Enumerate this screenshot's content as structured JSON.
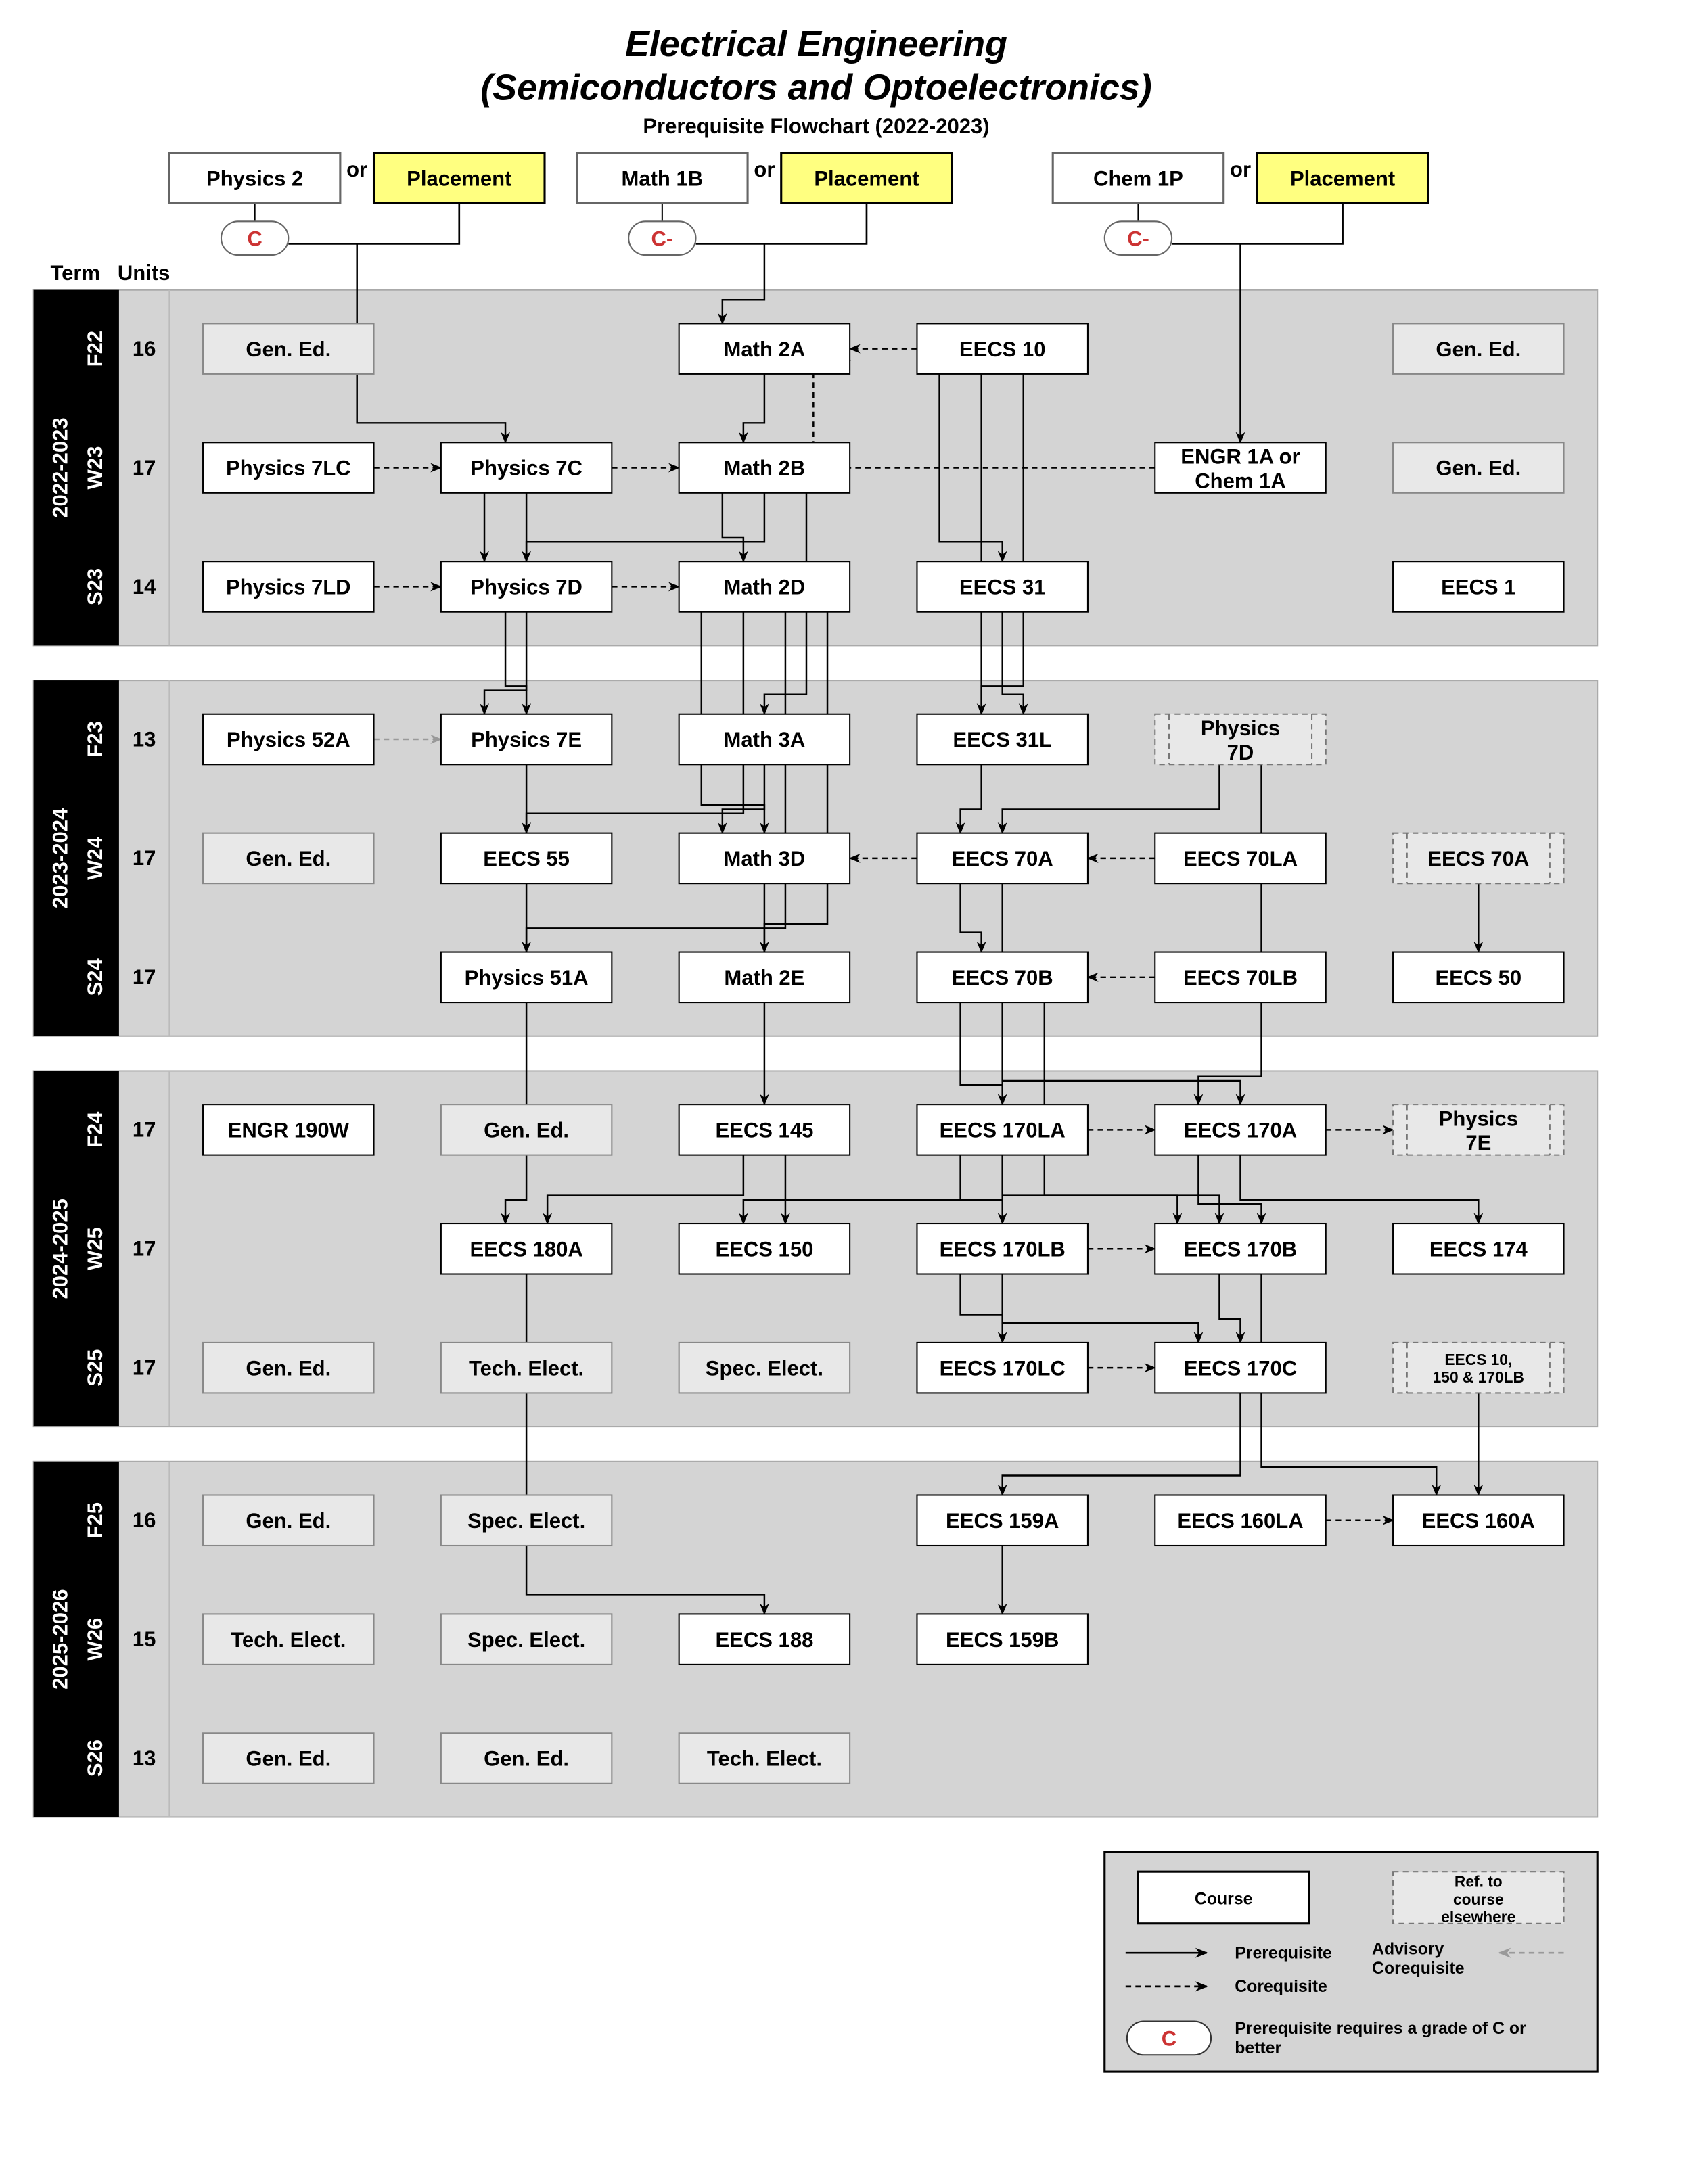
{
  "title": "Electrical Engineering",
  "subtitle_line": "(Semiconductors and Optoelectronics)",
  "caption": "Prerequisite Flowchart (2022-2023)",
  "header": {
    "term": "Term",
    "units": "Units"
  },
  "colors": {
    "band": "#d4d4d4",
    "placement": "#ffff80",
    "gen_ed": "#e8e8e8",
    "grade": "#cc3333",
    "advisory": "#999999"
  },
  "entry": [
    {
      "left": "Physics 2",
      "or": "or",
      "right": "Placement",
      "grade": "C"
    },
    {
      "left": "Math 1B",
      "or": "or",
      "right": "Placement",
      "grade": "C-"
    },
    {
      "left": "Chem 1P",
      "or": "or",
      "right": "Placement",
      "grade": "C-"
    }
  ],
  "years": [
    "2022-2023",
    "2023-2024",
    "2024-2025",
    "2025-2026"
  ],
  "terms": [
    {
      "label": "F22",
      "units": "16"
    },
    {
      "label": "W23",
      "units": "17"
    },
    {
      "label": "S23",
      "units": "14"
    },
    {
      "label": "F23",
      "units": "13"
    },
    {
      "label": "W24",
      "units": "17"
    },
    {
      "label": "S24",
      "units": "17"
    },
    {
      "label": "F24",
      "units": "17"
    },
    {
      "label": "W25",
      "units": "17"
    },
    {
      "label": "S25",
      "units": "17"
    },
    {
      "label": "F25",
      "units": "16"
    },
    {
      "label": "W26",
      "units": "15"
    },
    {
      "label": "S26",
      "units": "13"
    }
  ],
  "courses": [
    {
      "id": "ge1",
      "label": "Gen. Ed.",
      "term": 0,
      "col": 0,
      "kind": "gen"
    },
    {
      "id": "m2a",
      "label": "Math 2A",
      "term": 0,
      "col": 2
    },
    {
      "id": "e10",
      "label": "EECS 10",
      "term": 0,
      "col": 3
    },
    {
      "id": "ge2",
      "label": "Gen. Ed.",
      "term": 0,
      "col": 5,
      "kind": "gen"
    },
    {
      "id": "p7lc",
      "label": "Physics 7LC",
      "term": 1,
      "col": 0
    },
    {
      "id": "p7c",
      "label": "Physics 7C",
      "term": 1,
      "col": 1
    },
    {
      "id": "m2b",
      "label": "Math 2B",
      "term": 1,
      "col": 2
    },
    {
      "id": "engr1a",
      "label": "ENGR 1A or|Chem 1A",
      "term": 1,
      "col": 4
    },
    {
      "id": "ge3",
      "label": "Gen. Ed.",
      "term": 1,
      "col": 5,
      "kind": "gen"
    },
    {
      "id": "p7ld",
      "label": "Physics 7LD",
      "term": 2,
      "col": 0
    },
    {
      "id": "p7d",
      "label": "Physics 7D",
      "term": 2,
      "col": 1
    },
    {
      "id": "m2d",
      "label": "Math 2D",
      "term": 2,
      "col": 2
    },
    {
      "id": "e31",
      "label": "EECS 31",
      "term": 2,
      "col": 3
    },
    {
      "id": "e1",
      "label": "EECS 1",
      "term": 2,
      "col": 5
    },
    {
      "id": "p52a",
      "label": "Physics 52A",
      "term": 3,
      "col": 0
    },
    {
      "id": "p7e",
      "label": "Physics 7E",
      "term": 3,
      "col": 1
    },
    {
      "id": "m3a",
      "label": "Math 3A",
      "term": 3,
      "col": 2
    },
    {
      "id": "e31l",
      "label": "EECS 31L",
      "term": 3,
      "col": 3
    },
    {
      "id": "r7d",
      "label": "Physics|7D",
      "term": 3,
      "col": 4,
      "kind": "ref"
    },
    {
      "id": "ge4",
      "label": "Gen. Ed.",
      "term": 4,
      "col": 0,
      "kind": "gen"
    },
    {
      "id": "e55",
      "label": "EECS 55",
      "term": 4,
      "col": 1
    },
    {
      "id": "m3d",
      "label": "Math 3D",
      "term": 4,
      "col": 2
    },
    {
      "id": "e70a",
      "label": "EECS 70A",
      "term": 4,
      "col": 3
    },
    {
      "id": "e70la",
      "label": "EECS 70LA",
      "term": 4,
      "col": 4
    },
    {
      "id": "r70a",
      "label": "EECS 70A",
      "term": 4,
      "col": 5,
      "kind": "ref"
    },
    {
      "id": "p51a",
      "label": "Physics 51A",
      "term": 5,
      "col": 1
    },
    {
      "id": "m2e",
      "label": "Math 2E",
      "term": 5,
      "col": 2
    },
    {
      "id": "e70b",
      "label": "EECS 70B",
      "term": 5,
      "col": 3
    },
    {
      "id": "e70lb",
      "label": "EECS 70LB",
      "term": 5,
      "col": 4
    },
    {
      "id": "e50",
      "label": "EECS 50",
      "term": 5,
      "col": 5
    },
    {
      "id": "engr190w",
      "label": "ENGR 190W",
      "term": 6,
      "col": 0
    },
    {
      "id": "ge5",
      "label": "Gen. Ed.",
      "term": 6,
      "col": 1,
      "kind": "gen"
    },
    {
      "id": "e145",
      "label": "EECS 145",
      "term": 6,
      "col": 2
    },
    {
      "id": "e170la",
      "label": "EECS 170LA",
      "term": 6,
      "col": 3
    },
    {
      "id": "e170a",
      "label": "EECS 170A",
      "term": 6,
      "col": 4
    },
    {
      "id": "r7e",
      "label": "Physics|7E",
      "term": 6,
      "col": 5,
      "kind": "ref"
    },
    {
      "id": "e180a",
      "label": "EECS 180A",
      "term": 7,
      "col": 1
    },
    {
      "id": "e150",
      "label": "EECS 150",
      "term": 7,
      "col": 2
    },
    {
      "id": "e170lb",
      "label": "EECS 170LB",
      "term": 7,
      "col": 3
    },
    {
      "id": "e170b",
      "label": "EECS 170B",
      "term": 7,
      "col": 4
    },
    {
      "id": "e174",
      "label": "EECS 174",
      "term": 7,
      "col": 5
    },
    {
      "id": "ge6",
      "label": "Gen. Ed.",
      "term": 8,
      "col": 0,
      "kind": "gen"
    },
    {
      "id": "te1",
      "label": "Tech. Elect.",
      "term": 8,
      "col": 1,
      "kind": "gen"
    },
    {
      "id": "se1",
      "label": "Spec. Elect.",
      "term": 8,
      "col": 2,
      "kind": "gen"
    },
    {
      "id": "e170lc",
      "label": "EECS 170LC",
      "term": 8,
      "col": 3
    },
    {
      "id": "e170c",
      "label": "EECS 170C",
      "term": 8,
      "col": 4
    },
    {
      "id": "rmulti",
      "label": "EECS 10,|150 & 170LB",
      "term": 8,
      "col": 5,
      "kind": "ref",
      "small": true
    },
    {
      "id": "ge7",
      "label": "Gen. Ed.",
      "term": 9,
      "col": 0,
      "kind": "gen"
    },
    {
      "id": "se2",
      "label": "Spec. Elect.",
      "term": 9,
      "col": 1,
      "kind": "gen"
    },
    {
      "id": "e159a",
      "label": "EECS 159A",
      "term": 9,
      "col": 3
    },
    {
      "id": "e160la",
      "label": "EECS 160LA",
      "term": 9,
      "col": 4
    },
    {
      "id": "e160a",
      "label": "EECS 160A",
      "term": 9,
      "col": 5
    },
    {
      "id": "te2",
      "label": "Tech. Elect.",
      "term": 10,
      "col": 0,
      "kind": "gen"
    },
    {
      "id": "se3",
      "label": "Spec. Elect.",
      "term": 10,
      "col": 1,
      "kind": "gen"
    },
    {
      "id": "e188",
      "label": "EECS 188",
      "term": 10,
      "col": 2
    },
    {
      "id": "e159b",
      "label": "EECS 159B",
      "term": 10,
      "col": 3
    },
    {
      "id": "ge8",
      "label": "Gen. Ed.",
      "term": 11,
      "col": 0,
      "kind": "gen"
    },
    {
      "id": "ge9",
      "label": "Gen. Ed.",
      "term": 11,
      "col": 1,
      "kind": "gen"
    },
    {
      "id": "te3",
      "label": "Tech. Elect.",
      "term": 11,
      "col": 2,
      "kind": "gen"
    }
  ],
  "edges": [
    {
      "from": "entry0",
      "to": "p7c",
      "type": "prereq"
    },
    {
      "from": "entry1",
      "to": "m2a",
      "type": "prereq"
    },
    {
      "from": "entry2",
      "to": "engr1a",
      "type": "prereq"
    },
    {
      "from": "e10",
      "to": "m2a",
      "type": "coreq"
    },
    {
      "from": "engr1a",
      "to": "m2a",
      "type": "coreq"
    },
    {
      "from": "p7lc",
      "to": "p7c",
      "type": "coreq"
    },
    {
      "from": "p7c",
      "to": "m2b",
      "type": "coreq"
    },
    {
      "from": "p7ld",
      "to": "p7d",
      "type": "coreq"
    },
    {
      "from": "p7d",
      "to": "m2d",
      "type": "coreq"
    },
    {
      "from": "p52a",
      "to": "p7e",
      "type": "advisory"
    },
    {
      "from": "e70a",
      "to": "m3d",
      "type": "coreq"
    },
    {
      "from": "e70la",
      "to": "e70a",
      "type": "coreq"
    },
    {
      "from": "e70lb",
      "to": "e70b",
      "type": "coreq"
    },
    {
      "from": "e170la",
      "to": "e170a",
      "type": "coreq"
    },
    {
      "from": "e170lb",
      "to": "e170b",
      "type": "coreq"
    },
    {
      "from": "e170lc",
      "to": "e170c",
      "type": "coreq"
    },
    {
      "from": "e170a",
      "to": "r7e",
      "type": "coreq"
    },
    {
      "from": "e160la",
      "to": "e160a",
      "type": "coreq"
    },
    {
      "from": "m2a",
      "to": "m2b",
      "type": "prereq"
    },
    {
      "from": "m2b",
      "to": "m2d",
      "type": "prereq"
    },
    {
      "from": "p7c",
      "to": "p7d",
      "type": "prereq"
    },
    {
      "from": "m2b",
      "to": "p7d",
      "type": "prereq"
    },
    {
      "from": "p7c",
      "to": "p7e",
      "type": "prereq"
    },
    {
      "from": "p7d",
      "to": "p7e",
      "type": "prereq"
    },
    {
      "from": "m2b",
      "to": "m3a",
      "type": "prereq"
    },
    {
      "from": "m3a",
      "to": "m3d",
      "type": "prereq"
    },
    {
      "from": "m2d",
      "to": "m3d",
      "type": "prereq"
    },
    {
      "from": "m2d",
      "to": "e55",
      "type": "prereq"
    },
    {
      "from": "m2d",
      "to": "p51a",
      "type": "prereq"
    },
    {
      "from": "m2d",
      "to": "m2e",
      "type": "prereq"
    },
    {
      "from": "e10",
      "to": "e31",
      "type": "prereq"
    },
    {
      "from": "e10",
      "to": "e70a",
      "type": "prereq"
    },
    {
      "from": "e10",
      "to": "e31l",
      "type": "prereq"
    },
    {
      "from": "e31",
      "to": "e31l",
      "type": "prereq"
    },
    {
      "from": "r7d",
      "to": "e70a",
      "type": "prereq"
    },
    {
      "from": "r7d",
      "to": "e170a",
      "type": "prereq"
    },
    {
      "from": "e70a",
      "to": "e70b",
      "type": "prereq"
    },
    {
      "from": "e70a",
      "to": "e150",
      "type": "prereq"
    },
    {
      "from": "r70a",
      "to": "e50",
      "type": "prereq"
    },
    {
      "from": "e70b",
      "to": "e170la",
      "type": "prereq"
    },
    {
      "from": "e70b",
      "to": "e170a",
      "type": "prereq"
    },
    {
      "from": "e70b",
      "to": "e170b",
      "type": "prereq"
    },
    {
      "from": "m3d",
      "to": "e145",
      "type": "prereq"
    },
    {
      "from": "p7e",
      "to": "e180a",
      "type": "prereq"
    },
    {
      "from": "e145",
      "to": "e180a",
      "type": "prereq"
    },
    {
      "from": "e145",
      "to": "e150",
      "type": "prereq"
    },
    {
      "from": "e170la",
      "to": "e170lb",
      "type": "prereq"
    },
    {
      "from": "e170la",
      "to": "e170b",
      "type": "prereq"
    },
    {
      "from": "e170a",
      "to": "e170b",
      "type": "prereq"
    },
    {
      "from": "e170a",
      "to": "e174",
      "type": "prereq"
    },
    {
      "from": "e170lb",
      "to": "e170lc",
      "type": "prereq"
    },
    {
      "from": "e170lb",
      "to": "e170c",
      "type": "prereq"
    },
    {
      "from": "e170b",
      "to": "e170c",
      "type": "prereq"
    },
    {
      "from": "e170b",
      "to": "e160a",
      "type": "prereq"
    },
    {
      "from": "e170c",
      "to": "e159a",
      "type": "prereq"
    },
    {
      "from": "rmulti",
      "to": "e160a",
      "type": "prereq"
    },
    {
      "from": "e159a",
      "to": "e159b",
      "type": "prereq"
    },
    {
      "from": "e180a",
      "to": "e188",
      "type": "prereq"
    }
  ],
  "legend": {
    "course": "Course",
    "ref": "Ref. to|course|elsewhere",
    "prereq": "Prerequisite",
    "coreq": "Corequisite",
    "advisory": "Advisory|Corequisite",
    "grade": "C",
    "grade_text": "Prerequisite requires a grade of C or|better"
  }
}
